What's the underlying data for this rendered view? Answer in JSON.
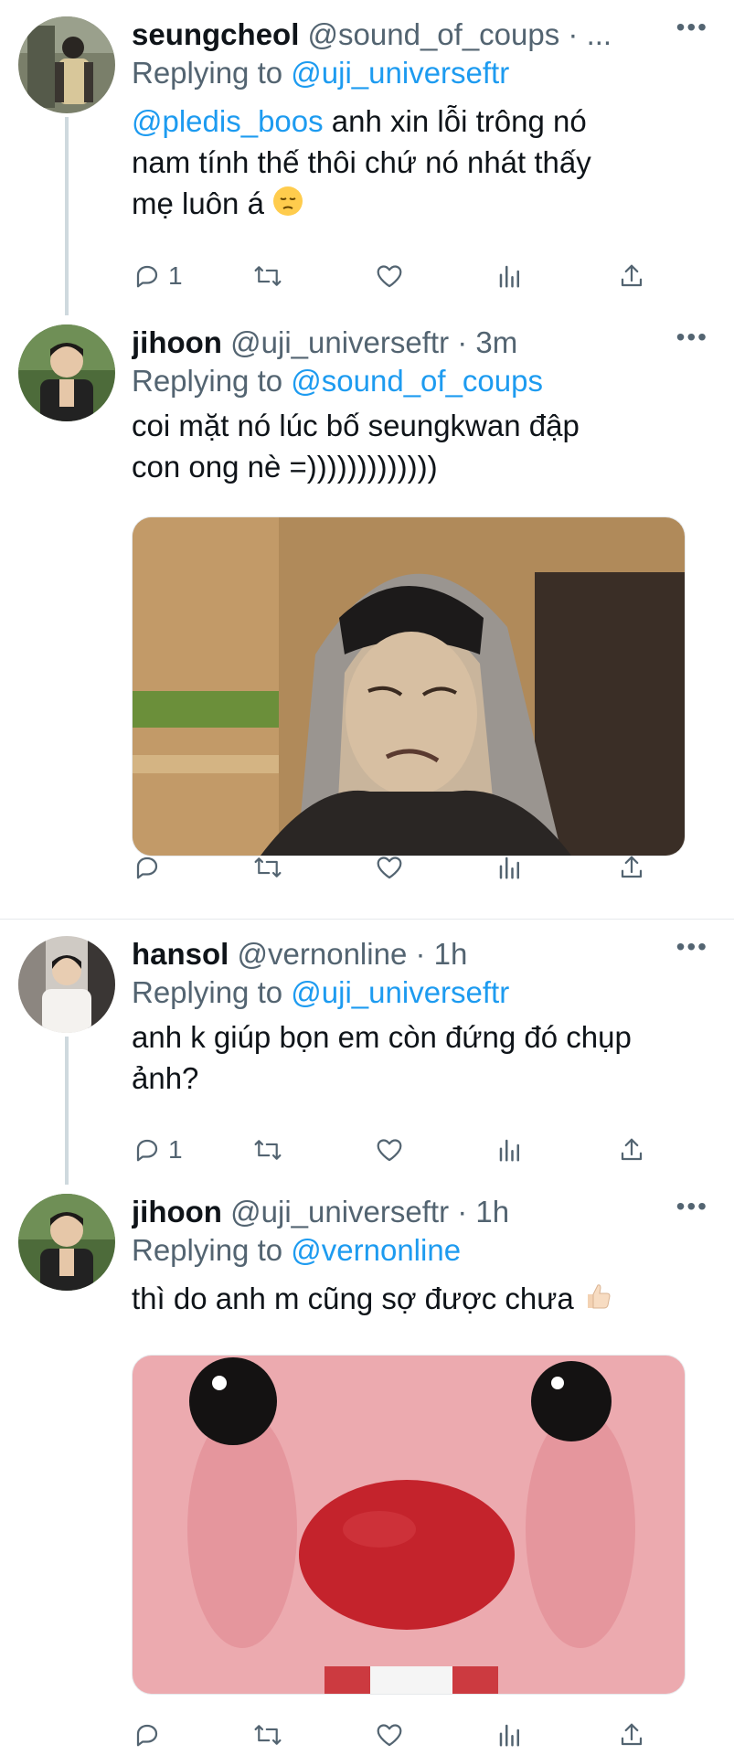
{
  "tweets": [
    {
      "name": "seungcheol",
      "handle": "@sound_of_coups",
      "meta": "· ...",
      "replying_prefix": "Replying to",
      "replying_to": "@uji_universeftr",
      "body_mention": "@pledis_boos",
      "body_line1": " anh xin lỗi trông nó",
      "body_line2": "nam tính thế thôi chứ nó nhát thấy",
      "body_line3": "mẹ luôn á",
      "emoji": "pensive-face",
      "reply_count": "1"
    },
    {
      "name": "jihoon",
      "handle": "@uji_universeftr",
      "meta": "· 3m",
      "replying_prefix": "Replying to",
      "replying_to": "@sound_of_coups",
      "body_line1": "coi mặt nó lúc bố seungkwan đập",
      "body_line2": "con ong nè =)))))))))))))",
      "media": "photo-grimacing-person-in-hoodie",
      "reply_count": ""
    },
    {
      "name": "hansol",
      "handle": "@vernonline",
      "meta": "· 1h",
      "replying_prefix": "Replying to",
      "replying_to": "@uji_universeftr",
      "body_line1": "anh k giúp bọn em còn đứng đó chụp",
      "body_line2": "ảnh?",
      "reply_count": "1"
    },
    {
      "name": "jihoon",
      "handle": "@uji_universeftr",
      "meta": "· 1h",
      "replying_prefix": "Replying to",
      "replying_to": "@vernonline",
      "body_line1": "thì do anh m cũng sợ được chưa",
      "emoji": "thumbs-up-light-skin",
      "media": "photo-pink-plush-closeup",
      "reply_count": ""
    }
  ],
  "icons": {
    "more": "more-icon",
    "reply": "reply-icon",
    "retweet": "retweet-icon",
    "like": "like-icon",
    "analytics": "analytics-icon",
    "share": "share-icon"
  },
  "colors": {
    "link": "#1d9bf0",
    "secondary": "#536471",
    "thread_line": "#cfd9de"
  }
}
